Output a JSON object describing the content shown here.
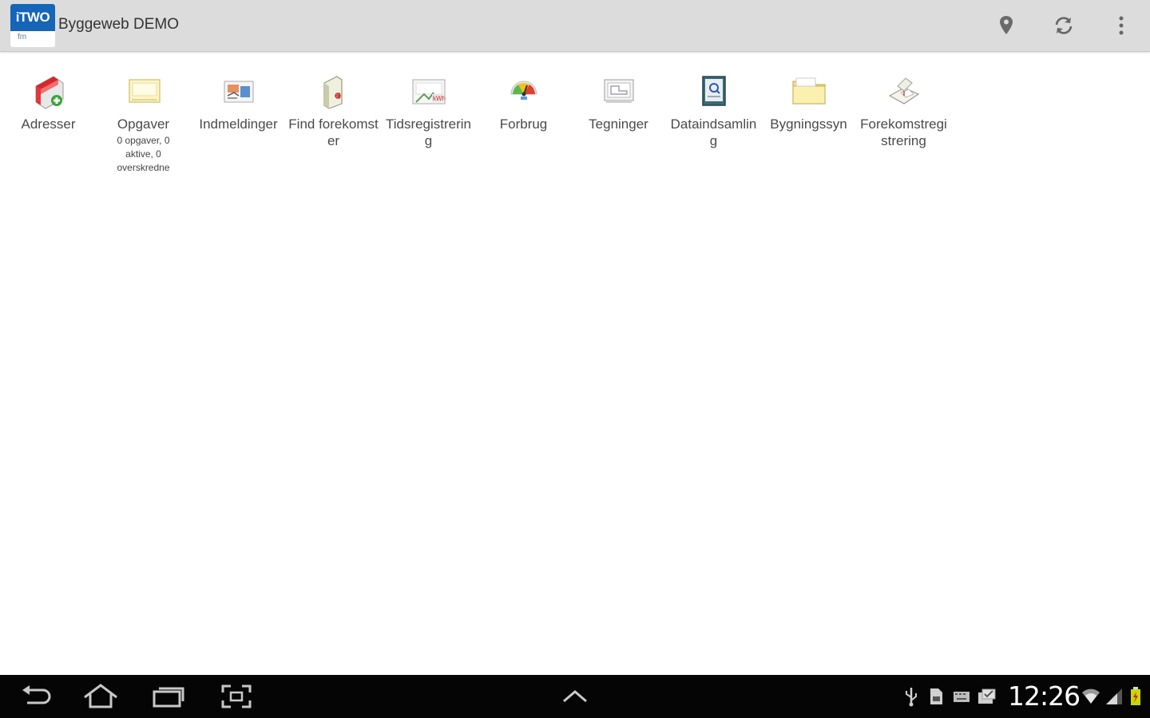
{
  "action_bar": {
    "logo": {
      "brand_text": "iTWO",
      "sub_text": "fm"
    },
    "title": "Byggeweb DEMO",
    "actions": [
      {
        "icon": "location-pin-icon"
      },
      {
        "icon": "refresh-icon"
      },
      {
        "icon": "overflow-menu-icon"
      }
    ]
  },
  "tiles": [
    {
      "label": "Adresser",
      "icon": "address-book-icon"
    },
    {
      "label": "Opgaver",
      "sub": "0 opgaver, 0 aktive, 0 overskredne",
      "icon": "tasks-icon"
    },
    {
      "label": "Indmeldinger",
      "icon": "reports-icon"
    },
    {
      "label": "Find forekomster",
      "icon": "find-document-icon"
    },
    {
      "label": "Tidsregistrering",
      "icon": "time-registration-icon"
    },
    {
      "label": "Forbrug",
      "icon": "consumption-gauge-icon"
    },
    {
      "label": "Tegninger",
      "icon": "drawings-icon"
    },
    {
      "label": "Dataindsamling",
      "icon": "data-collection-icon"
    },
    {
      "label": "Bygningssyn",
      "icon": "building-inspection-folder-icon"
    },
    {
      "label": "Forekomstregistrering",
      "icon": "occurrence-registration-icon"
    }
  ],
  "system_bar": {
    "nav": [
      {
        "icon": "back-icon"
      },
      {
        "icon": "home-icon"
      },
      {
        "icon": "recent-apps-icon"
      },
      {
        "icon": "screenshot-icon"
      },
      {
        "icon": "expand-up-icon"
      }
    ],
    "status_icons": [
      "usb-icon",
      "sd-card-icon",
      "keyboard-icon",
      "notification-icon"
    ],
    "clock": "12:26",
    "indicators": [
      "wifi-icon",
      "signal-icon",
      "battery-icon"
    ],
    "colors": {
      "battery": "#c8d800"
    }
  },
  "colors": {
    "brand": "#1565b8",
    "action_bar_bg": "#dcdcdc",
    "system_bar_bg": "#050505"
  }
}
